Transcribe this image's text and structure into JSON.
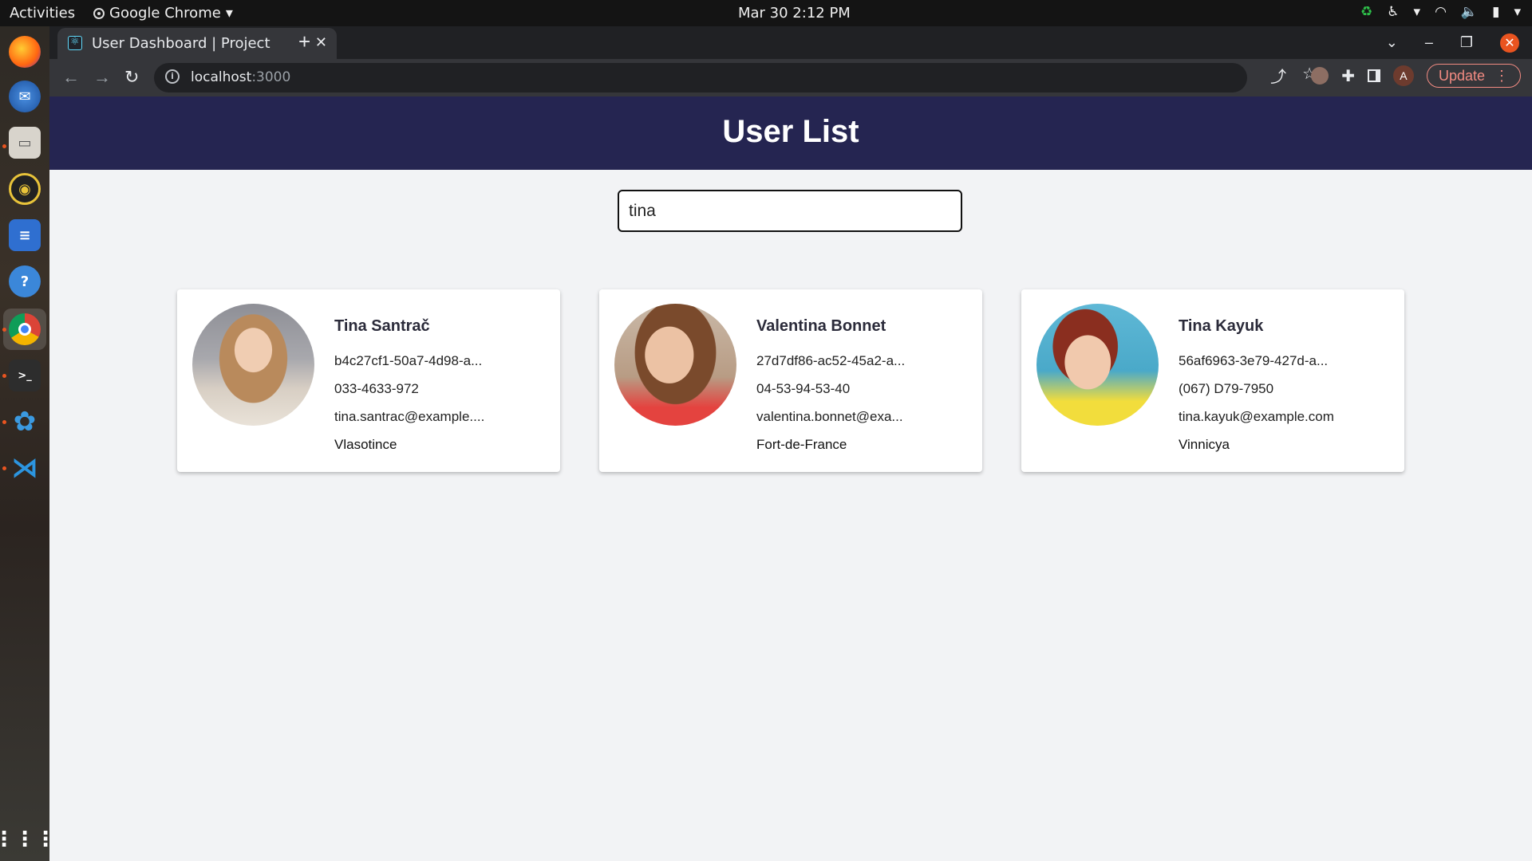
{
  "system_bar": {
    "activities": "Activities",
    "app_name": "Google Chrome",
    "clock": "Mar 30  2:12 PM"
  },
  "browser": {
    "tab_title": "User Dashboard | Project",
    "url_host": "localhost",
    "url_port": ":3000",
    "update_label": "Update"
  },
  "page": {
    "title": "User List",
    "search_value": "tina"
  },
  "users": [
    {
      "name": "Tina Santrač",
      "id": "b4c27cf1-50a7-4d98-a...",
      "phone": "033-4633-972",
      "email": "tina.santrac@example....",
      "city": "Vlasotince"
    },
    {
      "name": "Valentina Bonnet",
      "id": "27d7df86-ac52-45a2-a...",
      "phone": "04-53-94-53-40",
      "email": "valentina.bonnet@exa...",
      "city": "Fort-de-France"
    },
    {
      "name": "Tina Kayuk",
      "id": "56af6963-3e79-427d-a...",
      "phone": "(067) D79-7950",
      "email": "tina.kayuk@example.com",
      "city": "Vinnicya"
    }
  ],
  "colors": {
    "header_bg": "#252551",
    "page_bg": "#f2f3f5",
    "update_accent": "#f28b82"
  }
}
